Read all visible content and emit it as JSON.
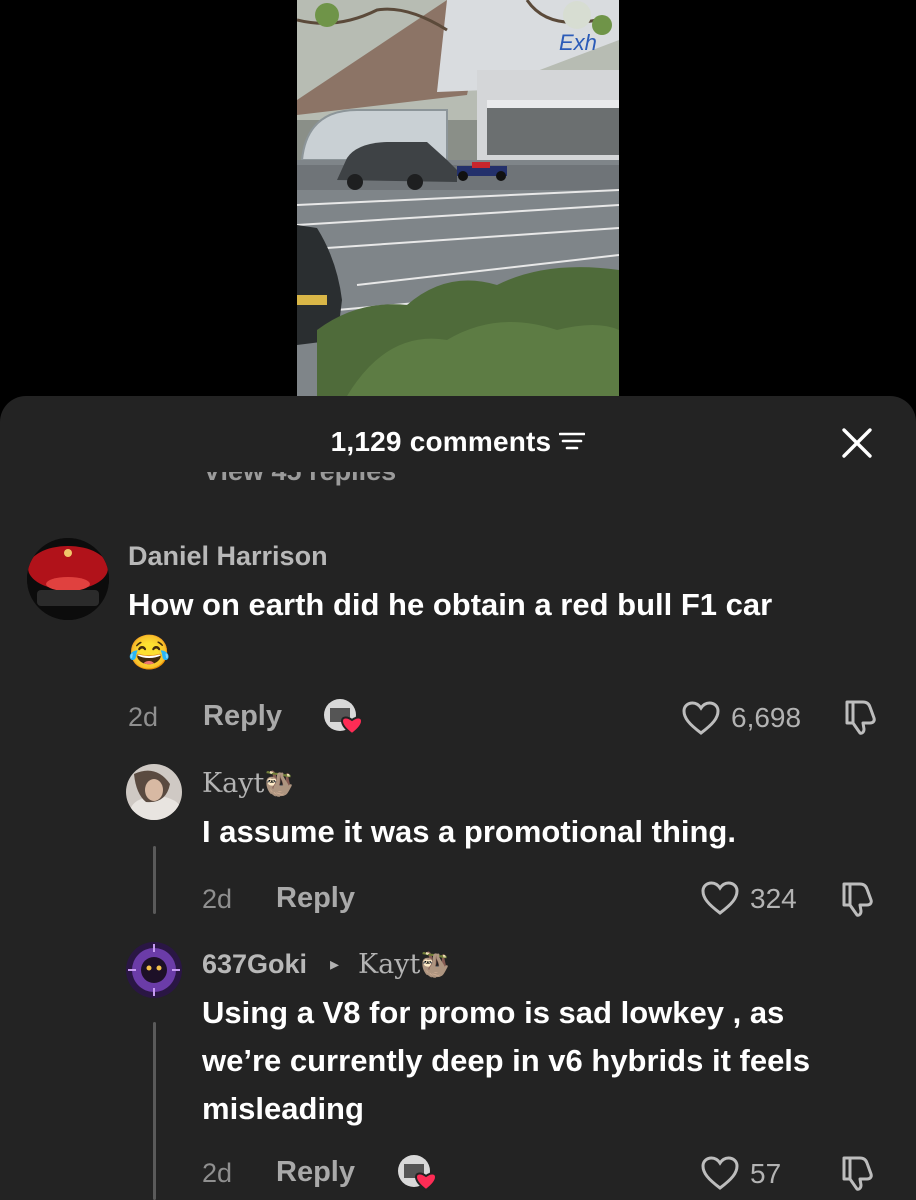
{
  "sheet": {
    "title": "1,129 comments",
    "partial_text": "View 45 replies"
  },
  "icons": {
    "sort": "sort-lines-icon",
    "close": "close-x-icon",
    "heart": "heart-outline-icon",
    "dislike": "thumbs-down-icon",
    "creator_like": "creator-liked-heart-icon"
  },
  "comments": [
    {
      "author": "Daniel Harrison",
      "text": "How on earth did he obtain a red bull F1 car",
      "emoji": "😂",
      "time": "2d",
      "reply_label": "Reply",
      "likes": "6,698"
    },
    {
      "author": "Kayt",
      "author_emoji": "🦥",
      "text": "I assume it was a promotional thing.",
      "time": "2d",
      "reply_label": "Reply",
      "likes": "324"
    },
    {
      "author": "637Goki",
      "reply_to": "Kayt",
      "reply_to_emoji": "🦥",
      "caret": "▸",
      "text_lines": [
        "Using a V8 for promo is sad lowkey , as",
        "we’re currently deep in v6 hybrids it feels",
        "misleading"
      ],
      "time": "2d",
      "reply_label": "Reply",
      "likes": "57"
    }
  ],
  "colors": {
    "sheet_bg": "#232323",
    "creator_heart": "#fe2c55",
    "secondary_text": "#b3b3b3"
  }
}
